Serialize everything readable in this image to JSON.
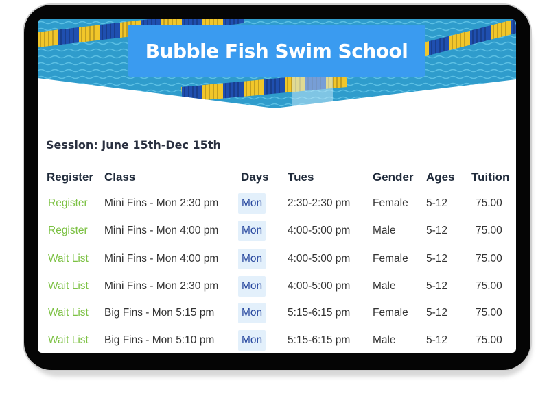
{
  "header": {
    "title": "Bubble Fish Swim School"
  },
  "session": "Session: June 15th-Dec 15th",
  "colors": {
    "title_bg": "#3a9bf0",
    "link": "#7cc143",
    "day_bg": "#e3f0fb"
  },
  "table": {
    "columns": [
      "Register",
      "Class",
      "Days",
      "Tues",
      "Gender",
      "Ages",
      "Tuition"
    ],
    "rows": [
      [
        "Register",
        "Mini Fins - Mon 2:30 pm",
        "Mon",
        "2:30-2:30 pm",
        "Female",
        "5-12",
        "75.00"
      ],
      [
        "Register",
        "Mini Fins - Mon 4:00 pm",
        "Mon",
        "4:00-5:00 pm",
        "Male",
        "5-12",
        "75.00"
      ],
      [
        "Wait List",
        "Mini Fins - Mon 4:00 pm",
        "Mon",
        "4:00-5:00 pm",
        "Female",
        "5-12",
        "75.00"
      ],
      [
        "Wait List",
        "Mini Fins - Mon 2:30 pm",
        "Mon",
        "4:00-5:00 pm",
        "Male",
        "5-12",
        "75.00"
      ],
      [
        "Wait List",
        "Big Fins - Mon 5:15 pm",
        "Mon",
        "5:15-6:15 pm",
        "Female",
        "5-12",
        "75.00"
      ],
      [
        "Wait List",
        "Big Fins - Mon 5:10 pm",
        "Mon",
        "5:15-6:15 pm",
        "Male",
        "5-12",
        "75.00"
      ]
    ]
  }
}
